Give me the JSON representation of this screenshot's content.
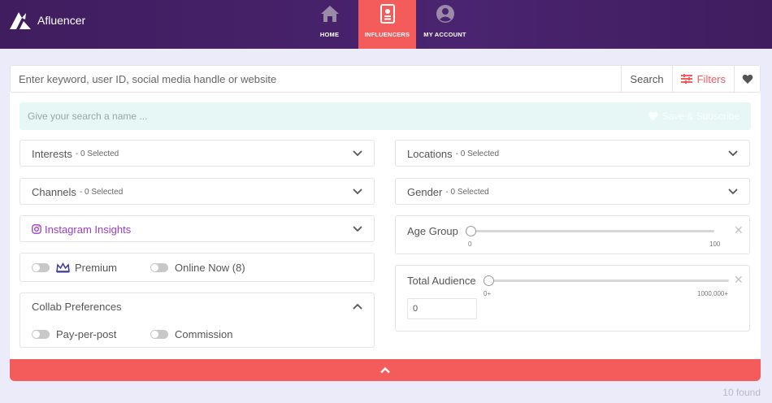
{
  "app": {
    "brand": "Afluencer"
  },
  "nav": [
    {
      "label": "HOME",
      "icon": "home-icon"
    },
    {
      "label": "INFLUENCERS",
      "icon": "profile-card-icon"
    },
    {
      "label": "MY ACCOUNT",
      "icon": "account-icon"
    }
  ],
  "search": {
    "placeholder": "Enter keyword, user ID, social media handle or website",
    "search_label": "Search",
    "filters_label": "Filters"
  },
  "save": {
    "placeholder": "Give your search a name ...",
    "button_label": "Save & Subscribe"
  },
  "filters": {
    "interests": {
      "title": "Interests",
      "selected": "- 0 Selected"
    },
    "channels": {
      "title": "Channels",
      "selected": "- 0 Selected"
    },
    "instagram": {
      "title": "Instagram Insights"
    },
    "locations": {
      "title": "Locations",
      "selected": "- 0 Selected"
    },
    "gender": {
      "title": "Gender",
      "selected": "- 0 Selected"
    },
    "premium_label": "Premium",
    "online_label": "Online Now (8)",
    "collab": {
      "title": "Collab Preferences",
      "pay_per_post": "Pay-per-post",
      "commission": "Commission"
    },
    "age_group": {
      "title": "Age Group",
      "min": "0",
      "max": "100",
      "value": 0
    },
    "total_audience": {
      "title": "Total Audience",
      "min": "0+",
      "max": "1000,000+",
      "value": 0,
      "input_value": "0"
    }
  },
  "results": {
    "found": "10 found"
  },
  "colors": {
    "accent": "#f45b5b",
    "nav_bg": "#3f1d5e",
    "instagram": "#9b3bc4"
  }
}
